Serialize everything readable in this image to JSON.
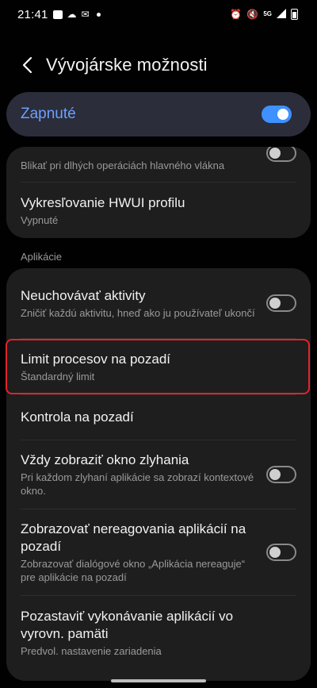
{
  "status_bar": {
    "time": "21:41",
    "network": "5G",
    "icons_left": [
      "image-icon",
      "cloud-icon",
      "mail-icon",
      "dot-icon"
    ],
    "icons_right": [
      "alarm-icon",
      "mute-icon",
      "signal-icon",
      "battery-icon"
    ]
  },
  "header": {
    "back_icon": "chevron-left-icon",
    "title": "Vývojárske možnosti"
  },
  "master_switch": {
    "label": "Zapnuté",
    "state": "on",
    "accent": "#3e91ff"
  },
  "card1": {
    "items": [
      {
        "title": "",
        "subtitle": "Blikať pri dlhých operáciách hlavného vlákna",
        "toggle": "off"
      },
      {
        "title": "Vykresľovanie HWUI profilu",
        "subtitle": "Vypnuté"
      }
    ]
  },
  "section": {
    "label": "Aplikácie"
  },
  "card2": {
    "items": [
      {
        "title": "Neuchovávať aktivity",
        "subtitle": "Zničiť každú aktivitu, hneď ako ju používateľ ukončí",
        "toggle": "off"
      },
      {
        "title": "Limit procesov na pozadí",
        "subtitle": "Štandardný limit",
        "highlighted": true
      },
      {
        "title": "Kontrola na pozadí",
        "subtitle": ""
      },
      {
        "title": "Vždy zobraziť okno zlyhania",
        "subtitle": "Pri každom zlyhaní aplikácie sa zobrazí kontextové okno.",
        "toggle": "off"
      },
      {
        "title": "Zobrazovať nereagovania aplikácií na pozadí",
        "subtitle": "Zobrazovať dialógové okno „Aplikácia nereaguje“ pre aplikácie na pozadí",
        "toggle": "off"
      },
      {
        "title": "Pozastaviť vykonávanie aplikácií vo vyrovn. pamäti",
        "subtitle": "Predvol. nastavenie zariadenia"
      }
    ]
  },
  "colors": {
    "background": "#010101",
    "card": "#1e1e1e",
    "master_bg": "#2b2d3a",
    "master_text": "#6ea0ff",
    "highlight_border": "#e0242b"
  }
}
